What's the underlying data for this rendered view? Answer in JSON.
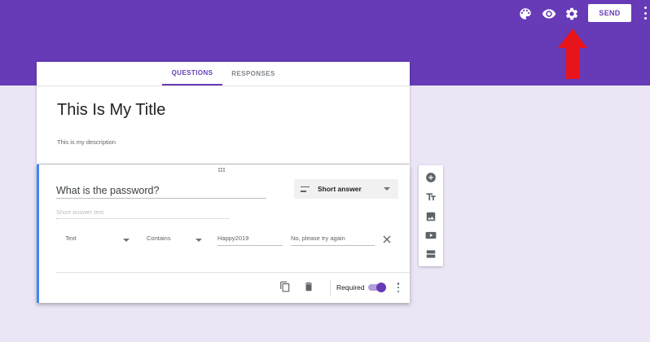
{
  "colors": {
    "brand_purple": "#673ab7",
    "page_background": "#ebe5f5",
    "question_accent": "#4285f4",
    "annotation_arrow": "#e8141c"
  },
  "topbar": {
    "icons": [
      "palette-icon",
      "eye-icon",
      "gear-icon",
      "more-vert-icon"
    ],
    "send_label": "SEND"
  },
  "tabs": [
    {
      "label": "QUESTIONS",
      "active": true
    },
    {
      "label": "RESPONSES",
      "active": false
    }
  ],
  "form": {
    "title": "This Is My Title",
    "description": "This is my description"
  },
  "question": {
    "title": "What is the password?",
    "type_label": "Short answer",
    "answer_placeholder": "Short answer text",
    "validation": {
      "type": "Text",
      "condition": "Contains",
      "value": "Happy2019",
      "error_text": "No, please try again"
    },
    "required_label": "Required",
    "required": true
  },
  "side_toolbar": {
    "icons": [
      "add-question-icon",
      "title-text-icon",
      "image-icon",
      "video-icon",
      "section-icon"
    ]
  }
}
